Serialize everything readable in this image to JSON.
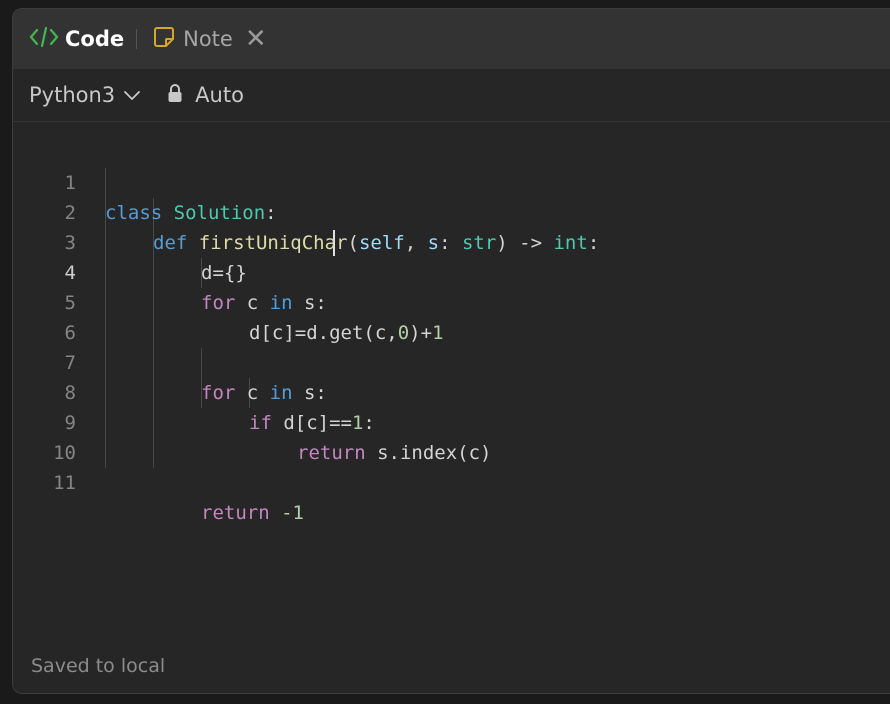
{
  "tabs": {
    "code_label": "Code",
    "note_label": "Note"
  },
  "toolbar": {
    "language": "Python3",
    "auto_label": "Auto"
  },
  "editor": {
    "line_numbers": [
      "1",
      "2",
      "3",
      "4",
      "5",
      "6",
      "7",
      "8",
      "9",
      "10",
      "11"
    ],
    "active_line": "4",
    "tokens": {
      "l1_class": "class",
      "l1_name": "Solution",
      "l1_colon": ":",
      "l2_def": "def",
      "l2_fn": "firstUniqChar",
      "l2_open": "(",
      "l2_self": "self",
      "l2_comma": ", ",
      "l2_s": "s",
      "l2_colon": ": ",
      "l2_str": "str",
      "l2_arrow": ") -> ",
      "l2_int": "int",
      "l2_end": ":",
      "l3": "d={}",
      "l4_for": "for",
      "l4_c": " c ",
      "l4_in": "in",
      "l4_s": " s:",
      "l5_a": "d[c]=d.get(c,",
      "l5_zero": "0",
      "l5_b": ")+",
      "l5_one": "1",
      "l7_for": "for",
      "l7_c": " c ",
      "l7_in": "in",
      "l7_s": " s:",
      "l8_if": "if",
      "l8_a": " d[c]==",
      "l8_one": "1",
      "l8_colon": ":",
      "l9_return": "return",
      "l9_rest": " s.index(c)",
      "l11_return": "return",
      "l11_sp": " ",
      "l11_val": "-1"
    }
  },
  "status": {
    "text": "Saved to local"
  },
  "colors": {
    "keyword_blue": "#569cd6",
    "keyword_purple": "#c586c0",
    "class_name": "#4ec9b0",
    "function_name": "#dcdcaa",
    "number": "#b5cea8",
    "code_icon_green": "#3fb950",
    "note_icon_orange": "#d4a72c"
  }
}
